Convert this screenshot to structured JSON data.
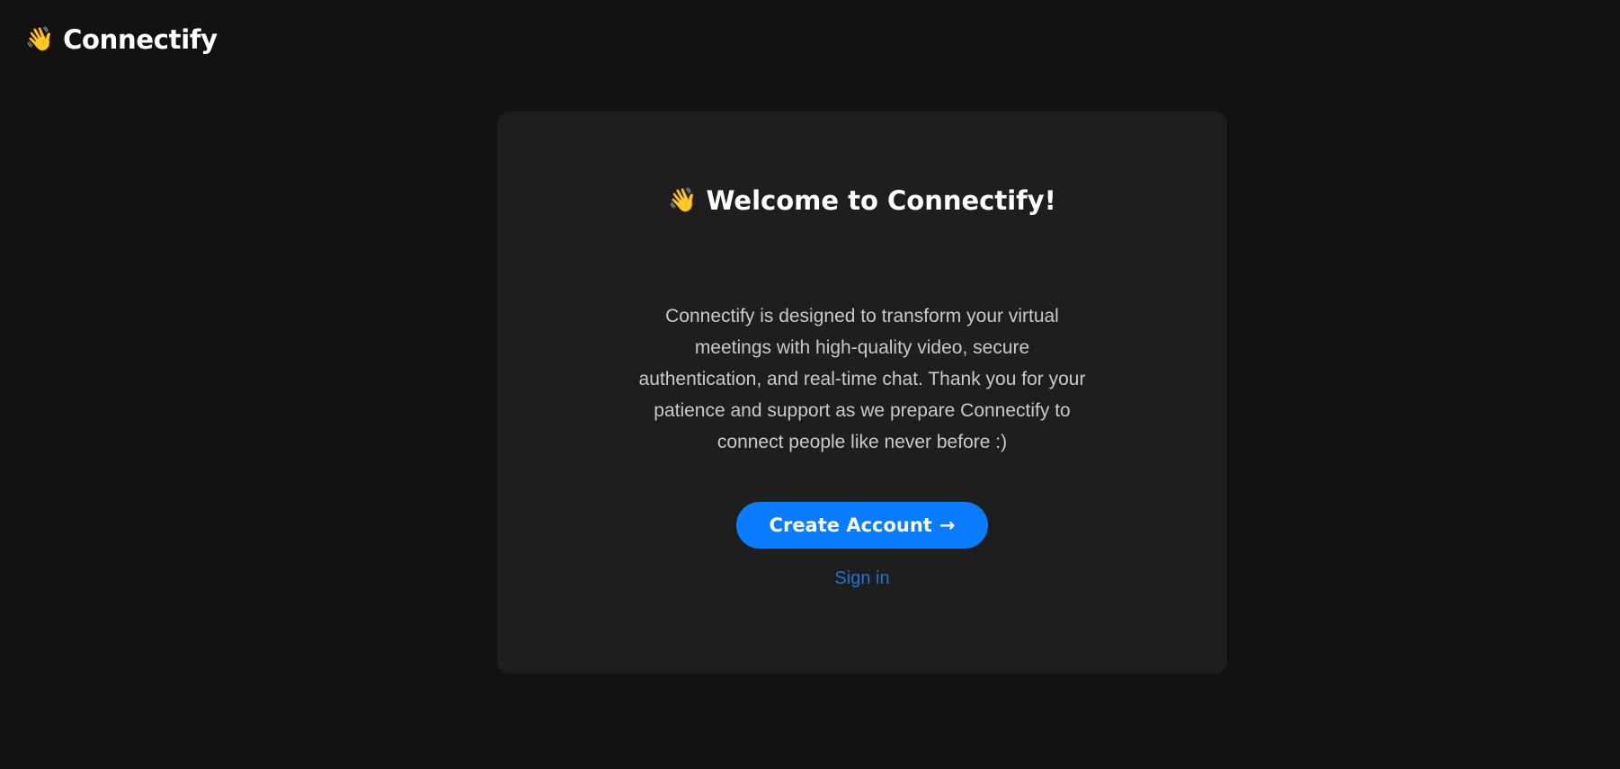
{
  "header": {
    "brand_icon": "👋",
    "brand_name": "Connectify"
  },
  "card": {
    "welcome_icon": "👋",
    "welcome_text": "Welcome to Connectify!",
    "description": "Connectify is designed to transform your virtual meetings with high-quality video, secure authentication, and real-time chat. Thank you for your patience and support as we prepare Connectify to connect people like never before :)",
    "cta_label": "Create Account",
    "cta_arrow": "→",
    "signin_label": "Sign in"
  },
  "colors": {
    "background": "#121212",
    "card": "#1e1e1e",
    "accent": "#0a7cff",
    "link": "#1e73d8"
  }
}
